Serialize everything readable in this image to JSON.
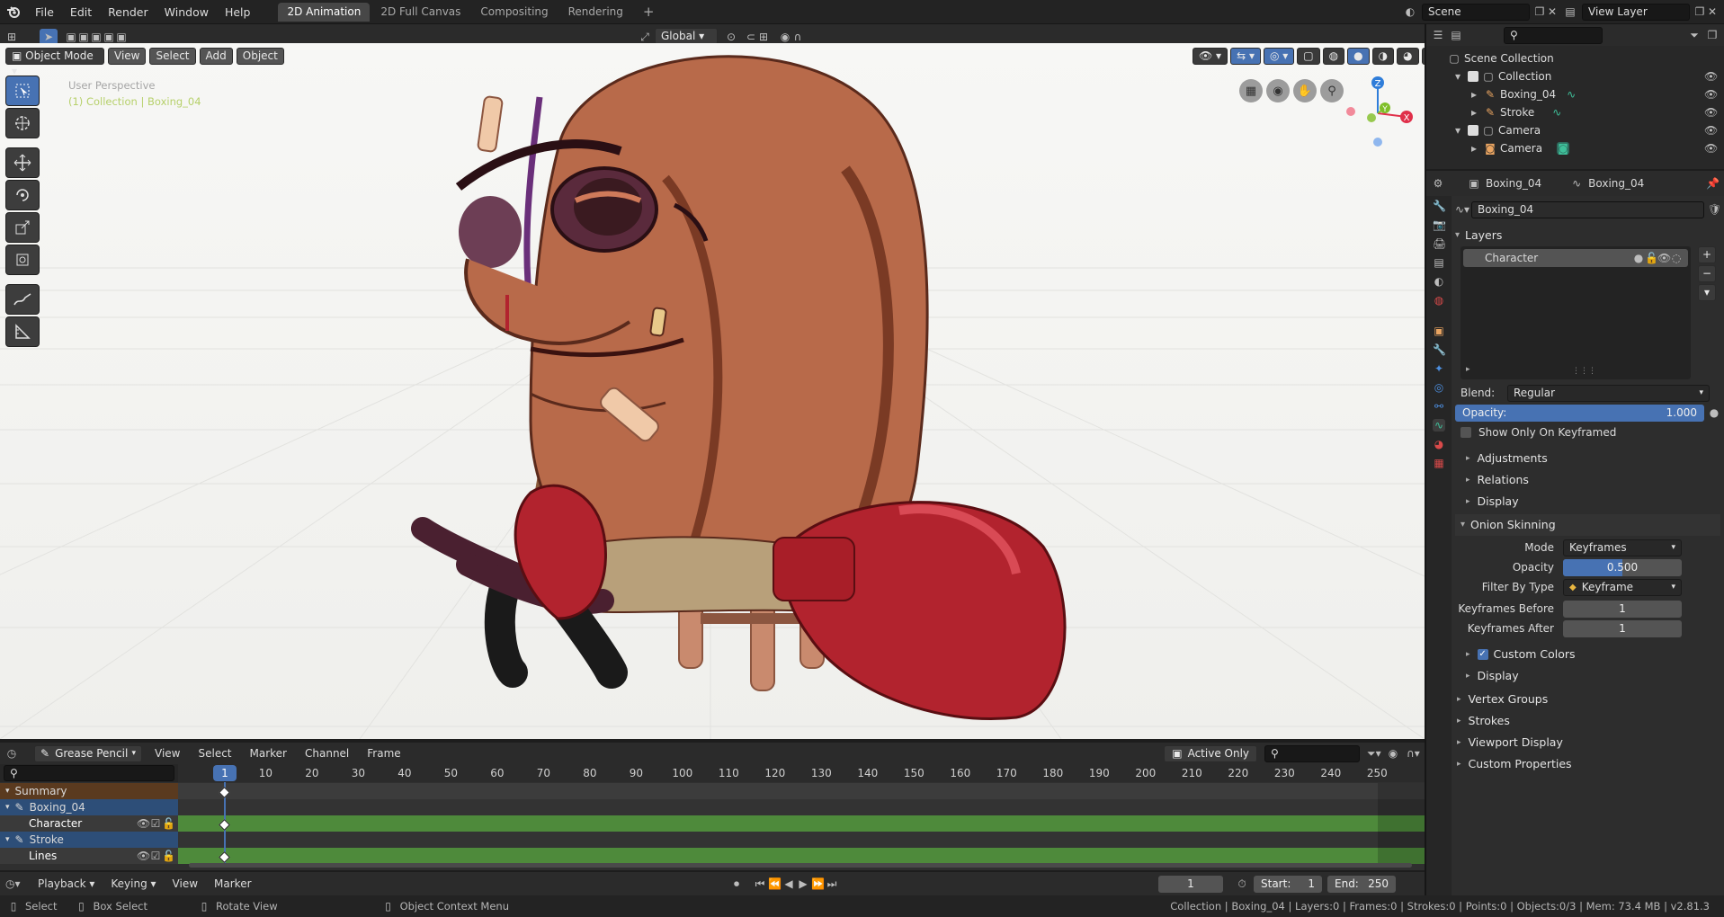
{
  "topbar": {
    "menus": [
      "File",
      "Edit",
      "Render",
      "Window",
      "Help"
    ],
    "workspaces": [
      "2D Animation",
      "2D Full Canvas",
      "Compositing",
      "Rendering"
    ],
    "active_workspace": "2D Animation",
    "add_workspace": "+",
    "scene": "Scene",
    "view_layer": "View Layer"
  },
  "viewport_header": {
    "mode": "Object Mode",
    "menus": [
      "View",
      "Select",
      "Add",
      "Object"
    ],
    "orientation": "Global"
  },
  "viewport": {
    "perspective": "User Perspective",
    "collection_info": "(1) Collection | Boxing_04",
    "gizmo_axes": {
      "x": "X",
      "y": "Y",
      "z": "Z"
    }
  },
  "outliner": {
    "root": "Scene Collection",
    "items": [
      {
        "label": "Collection",
        "level": 1
      },
      {
        "label": "Boxing_04",
        "level": 2
      },
      {
        "label": "Stroke",
        "level": 2
      },
      {
        "label": "Camera",
        "level": 1
      },
      {
        "label": "Camera",
        "level": 2
      }
    ]
  },
  "properties": {
    "object_name": "Boxing_04",
    "data_name": "Boxing_04",
    "datablock": "Boxing_04",
    "layers_label": "Layers",
    "layer_item": "Character",
    "blend_label": "Blend:",
    "blend_value": "Regular",
    "opacity_label": "Opacity:",
    "opacity_value": "1.000",
    "opacity_fraction": 1.0,
    "show_only_keyframed": "Show Only On Keyframed",
    "subpanels": [
      "Adjustments",
      "Relations",
      "Display"
    ],
    "onion": {
      "title": "Onion Skinning",
      "mode_label": "Mode",
      "mode_value": "Keyframes",
      "opacity_label": "Opacity",
      "opacity_value": "0.500",
      "opacity_fraction": 0.5,
      "filter_label": "Filter By Type",
      "filter_value": "Keyframe",
      "before_label": "Keyframes Before",
      "before_value": "1",
      "after_label": "Keyframes After",
      "after_value": "1",
      "custom_colors": "Custom Colors",
      "display": "Display"
    },
    "bottom_panels": [
      "Vertex Groups",
      "Strokes",
      "Viewport Display",
      "Custom Properties"
    ]
  },
  "timeline": {
    "editor": "Grease Pencil",
    "menus": [
      "View",
      "Select",
      "Marker",
      "Channel",
      "Frame"
    ],
    "active_only": "Active Only",
    "current_frame": "1",
    "ticks": [
      "10",
      "20",
      "30",
      "40",
      "50",
      "60",
      "70",
      "80",
      "90",
      "100",
      "110",
      "120",
      "130",
      "140",
      "150",
      "160",
      "170",
      "180",
      "190",
      "200",
      "210",
      "220",
      "230",
      "240",
      "250"
    ],
    "channels": [
      {
        "label": "Summary",
        "type": "summary"
      },
      {
        "label": "Boxing_04",
        "type": "object"
      },
      {
        "label": "Character",
        "type": "layer"
      },
      {
        "label": "Stroke",
        "type": "object"
      },
      {
        "label": "Lines",
        "type": "layer"
      }
    ]
  },
  "playback": {
    "menus": [
      "Playback",
      "Keying",
      "View",
      "Marker"
    ],
    "frame": "1",
    "start_label": "Start:",
    "start": "1",
    "end_label": "End:",
    "end": "250"
  },
  "status": {
    "select": "Select",
    "box_select": "Box Select",
    "rotate": "Rotate View",
    "context": "Object Context Menu",
    "info": "Collection | Boxing_04 | Layers:0 | Frames:0 | Strokes:0 | Points:0 | Objects:0/3 | Mem: 73.4 MB | v2.81.3"
  },
  "colors": {
    "accent": "#4772b3",
    "keyframe_row": "#4e8a3b",
    "summary_row": "#5a3a1f",
    "object_row": "#2d4e78"
  }
}
